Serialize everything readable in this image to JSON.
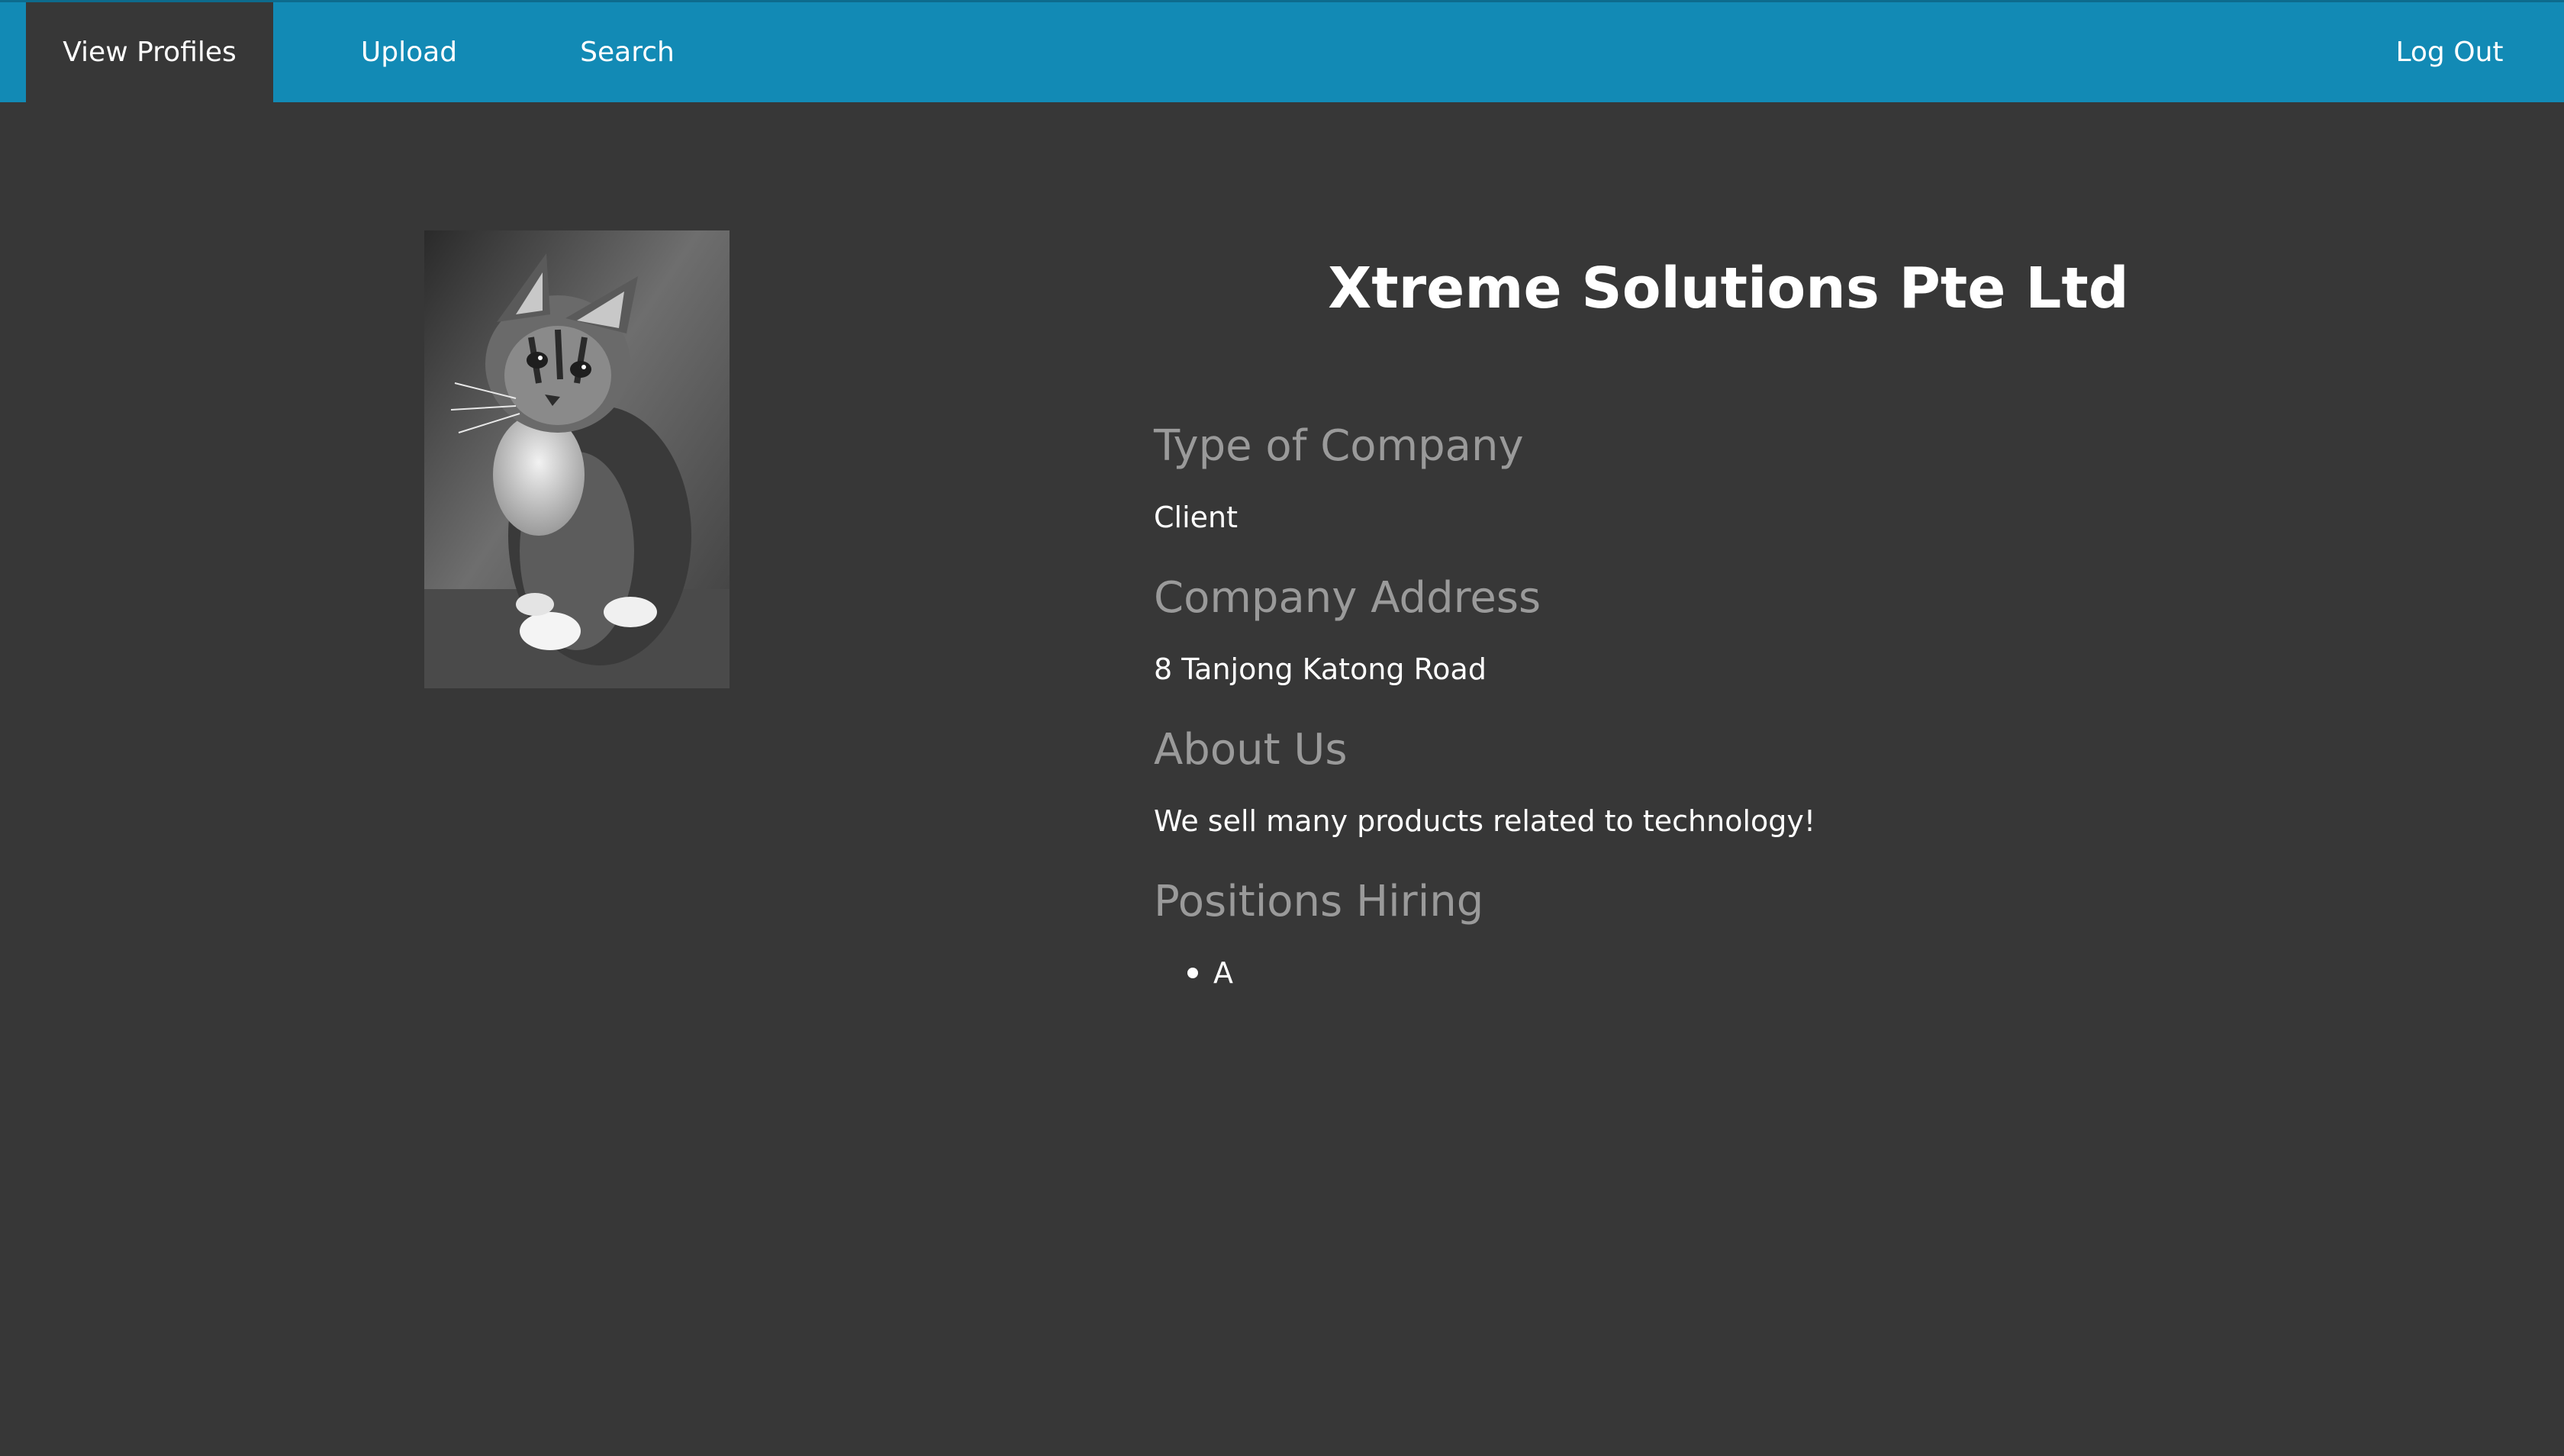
{
  "nav": {
    "view_profiles": "View Profiles",
    "upload": "Upload",
    "search": "Search",
    "log_out": "Log Out",
    "active_item": "View Profiles"
  },
  "profile": {
    "image_icon": "kitten-photo",
    "company_name": "Xtreme Solutions Pte Ltd",
    "sections": {
      "type_heading": "Type of Company",
      "type_value": "Client",
      "address_heading": "Company Address",
      "address_value": "8 Tanjong Katong Road",
      "about_heading": "About Us",
      "about_value": "We sell many products related to technology!",
      "positions_heading": "Positions Hiring",
      "positions": [
        "A"
      ]
    }
  },
  "colors": {
    "nav_bar": "#128ab5",
    "background": "#373737",
    "heading_grey": "#9a9a9a",
    "text_white": "#ffffff"
  }
}
